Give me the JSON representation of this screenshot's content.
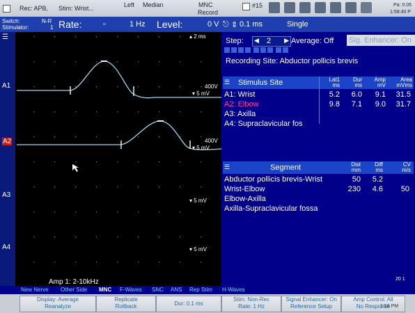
{
  "header": {
    "rec": "Rec: APB,",
    "stim": "Stim: Wrist...",
    "side": "Left",
    "nerve": "Median",
    "mode": "MNC",
    "record": "Record",
    "count": "#15",
    "right_text": "Pa: 0.05",
    "clock": "1:58:40 P"
  },
  "menu": {
    "switch": "Switch:",
    "switch_val": "N-R",
    "stimulator": "Stimulator:",
    "stimulator_val": "1",
    "rate_label": "Rate:",
    "rate_value": "1 Hz",
    "level_label": "Level:",
    "level_value": "0 V",
    "duration": "0.1 ms",
    "polarity": "Single"
  },
  "channels": {
    "a1": "A1",
    "a2": "A2",
    "a3": "A3",
    "a4": "A4",
    "time_scale": "2 ms",
    "a1_gain": "5 mV",
    "a1_sweep": "400V",
    "a2_gain": "5 mV",
    "a2_sweep": "400V",
    "a3_gain": "5 mV",
    "a4_gain": "5 mV",
    "amp": "Amp 1: 2-10kHz"
  },
  "step": {
    "label": "Step:",
    "value": "2",
    "average": "Average: Off",
    "enhancer": "Sig. Enhancer: On"
  },
  "recording_site": "Recording Site: Abductor pollicis brevis",
  "stim_table": {
    "title": "Stimulus Site",
    "col_lat": "Lat1",
    "col_lat_u": "ms",
    "col_dur": "Dur",
    "col_dur_u": "ms",
    "col_amp": "Amp",
    "col_amp_u": "mV",
    "col_area": "Area",
    "col_area_u": "mVms",
    "rows": [
      {
        "site": "A1: Wrist",
        "lat": "5.2",
        "dur": "6.0",
        "amp": "9.1",
        "area": "31.5"
      },
      {
        "site": "A2: Elbow",
        "lat": "9.8",
        "dur": "7.1",
        "amp": "9.0",
        "area": "31.7"
      },
      {
        "site": "A3: Axilla",
        "lat": "",
        "dur": "",
        "amp": "",
        "area": ""
      },
      {
        "site": "A4: Supraclavicular fos",
        "lat": "",
        "dur": "",
        "amp": "",
        "area": ""
      }
    ]
  },
  "seg_table": {
    "title": "Segment",
    "col_dist": "Dist",
    "col_dist_u": "mm",
    "col_diff": "Diff",
    "col_diff_u": "ms",
    "col_cv": "CV",
    "col_cv_u": "m/s",
    "rows": [
      {
        "seg": "Abductor pollicis brevis-Wrist",
        "dist": "50",
        "diff": "5.2",
        "cv": ""
      },
      {
        "seg": "Wrist-Elbow",
        "dist": "230",
        "diff": "4.6",
        "cv": "50"
      },
      {
        "seg": "Elbow-Axilla",
        "dist": "",
        "diff": "",
        "cv": ""
      },
      {
        "seg": "Axilla-Supraclavicular fossa",
        "dist": "",
        "diff": "",
        "cv": ""
      }
    ]
  },
  "tabs": [
    "New Nerve",
    "Other Side",
    "MNC",
    "F-Waves",
    "SNC",
    "ANS",
    "Rep Stim",
    "H-Waves"
  ],
  "buttons": {
    "b1a": "Display: Average",
    "b1b": "Reanalyze",
    "b2a": "Replicate",
    "b2b": "Rollback",
    "b3": "Dur: 0.1 ms",
    "b4a": "Stim: Non-Rec",
    "b4b": "Rate: 1 Hz",
    "b5a": "Signal Enhancer: On",
    "b5b": "Reference Setup",
    "b6a": "Amp Control: All",
    "b6b": "No Response",
    "page": "20 1",
    "tray_time": "1:58 PM"
  },
  "colors": {
    "trace": "#9fd8ee",
    "a2_site": "#ff3aa0",
    "panel": "#00008b",
    "menubar": "#1f3fae"
  }
}
